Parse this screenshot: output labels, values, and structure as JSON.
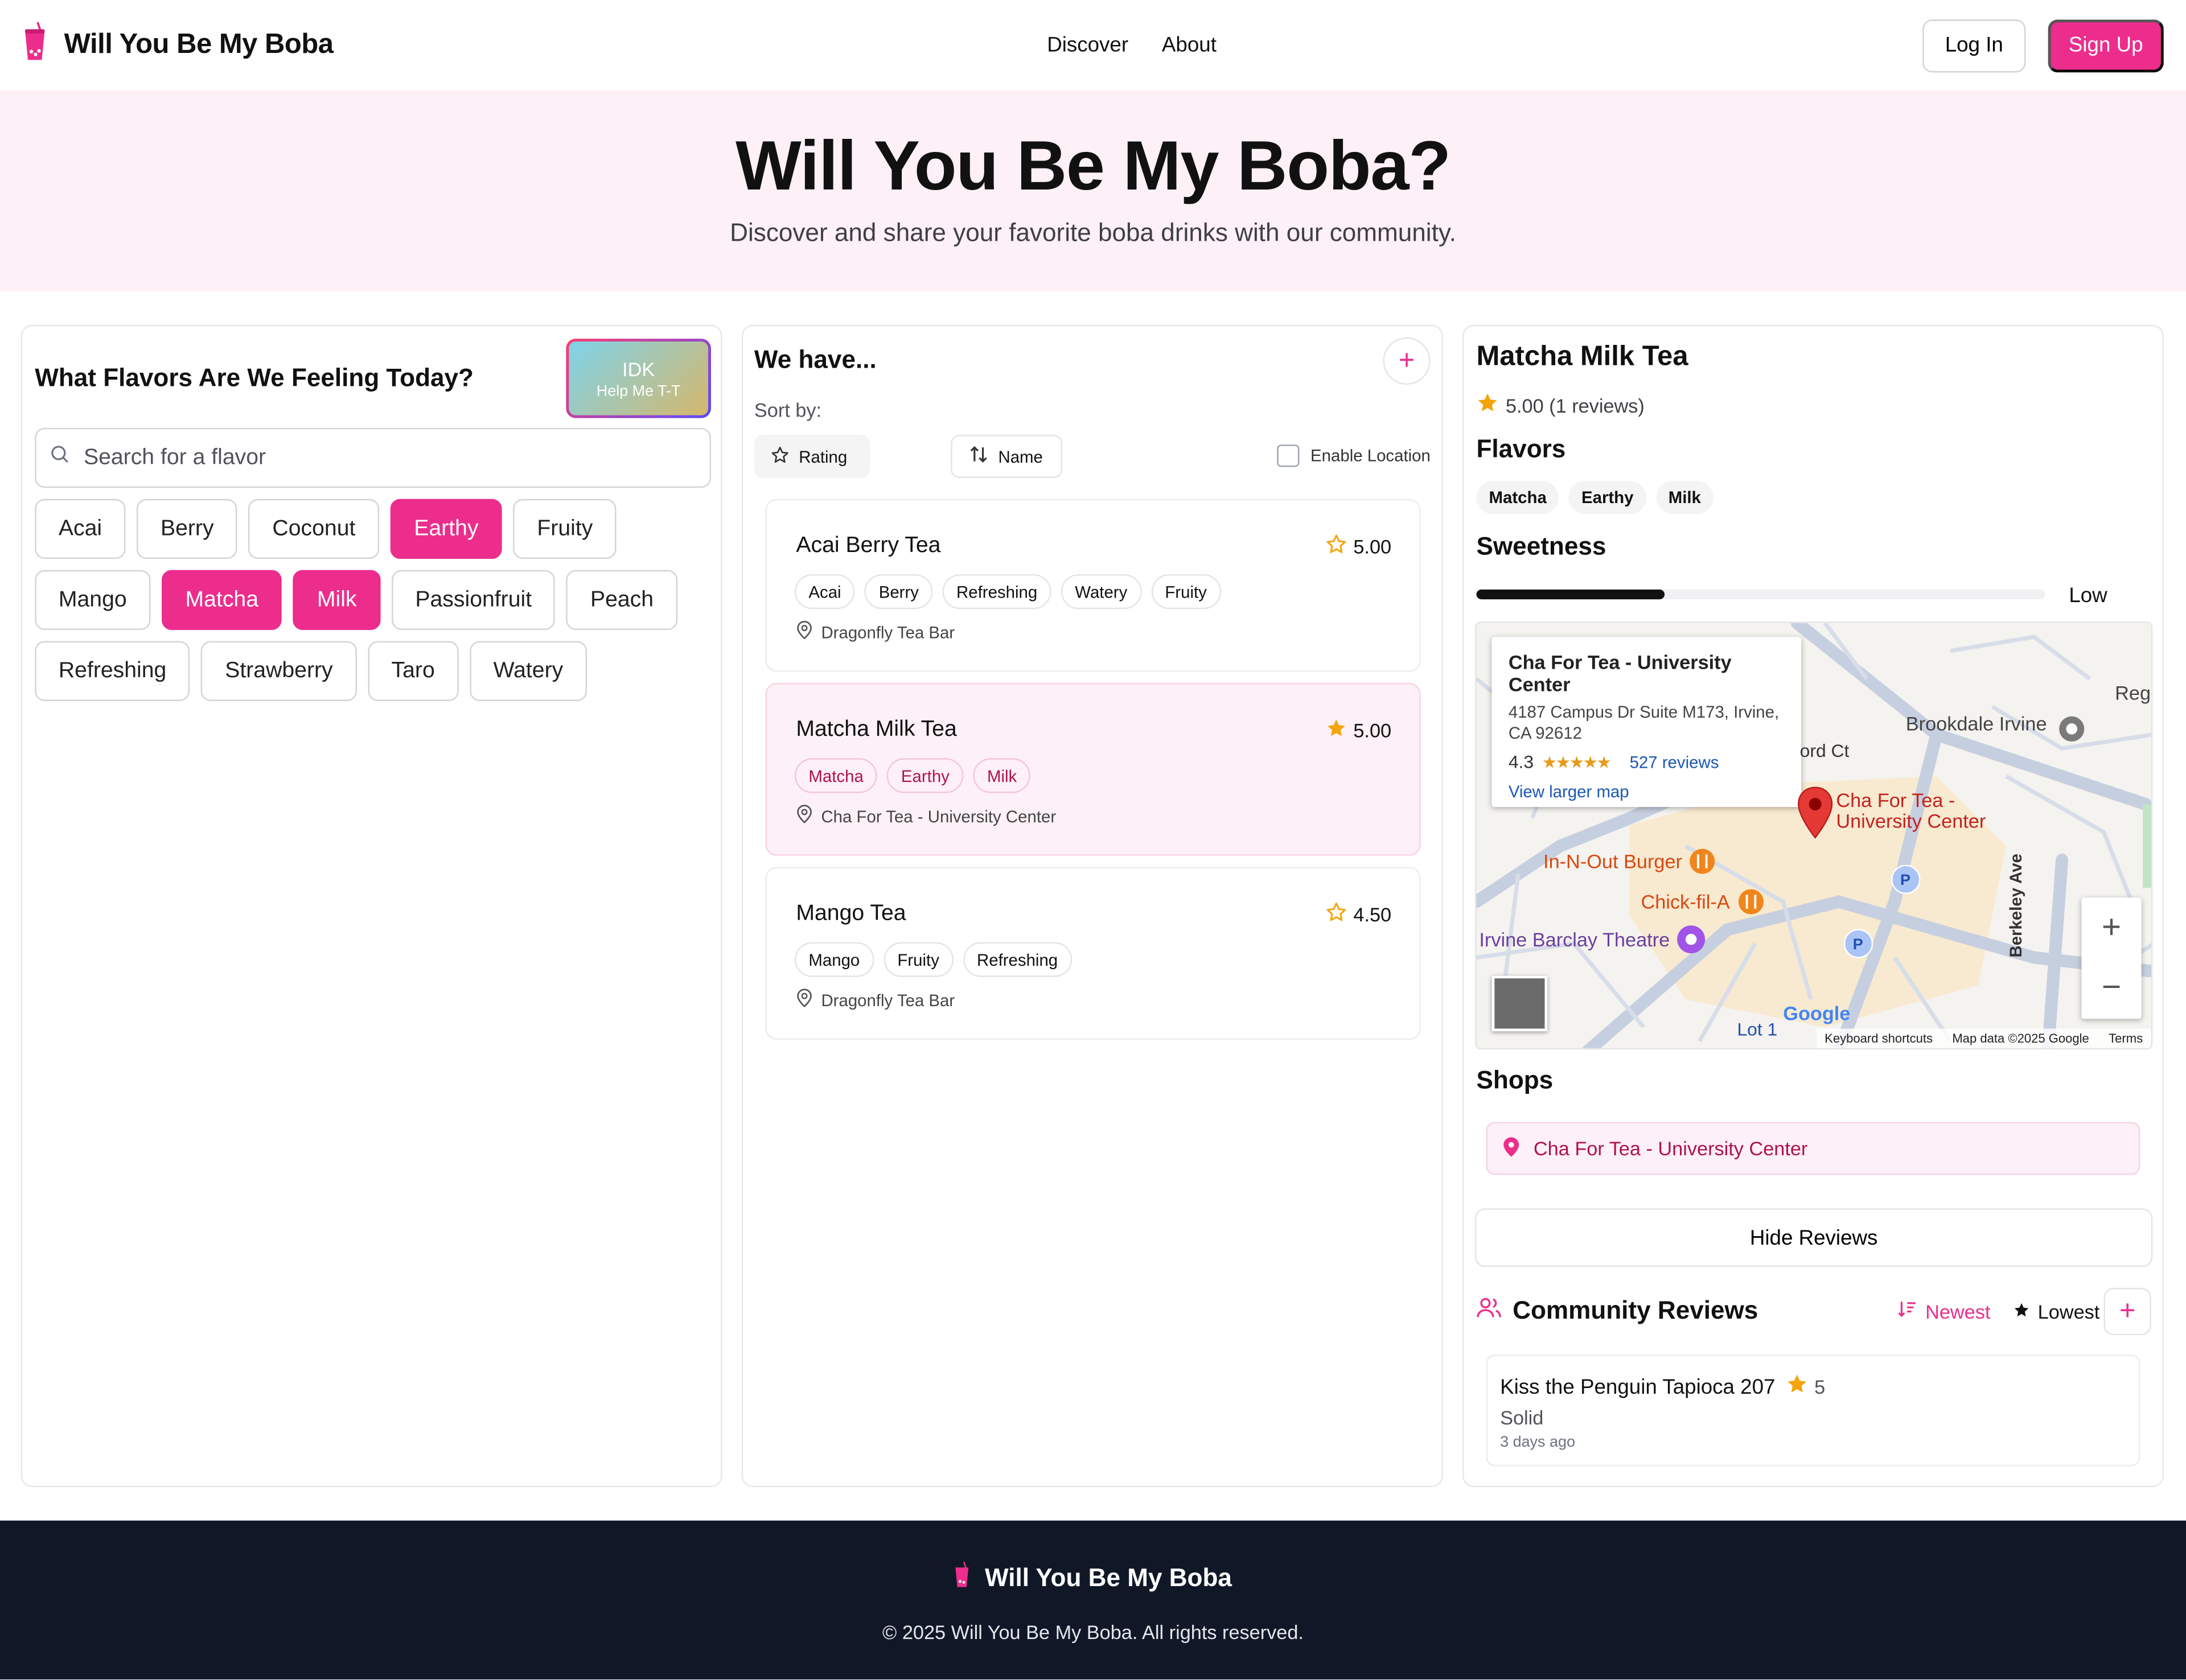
{
  "header": {
    "brand": "Will You Be My Boba",
    "nav": [
      "Discover",
      "About"
    ],
    "login": "Log In",
    "signup": "Sign Up"
  },
  "hero": {
    "title": "Will You Be My Boba?",
    "subtitle": "Discover and share your favorite boba drinks with our community."
  },
  "flavors_panel": {
    "title": "What Flavors Are We Feeling Today?",
    "idk_title": "IDK",
    "idk_sub": "Help Me T-T",
    "search_placeholder": "Search for a flavor",
    "chips": [
      {
        "label": "Acai",
        "selected": false
      },
      {
        "label": "Berry",
        "selected": false
      },
      {
        "label": "Coconut",
        "selected": false
      },
      {
        "label": "Earthy",
        "selected": true
      },
      {
        "label": "Fruity",
        "selected": false
      },
      {
        "label": "Mango",
        "selected": false
      },
      {
        "label": "Matcha",
        "selected": true
      },
      {
        "label": "Milk",
        "selected": true
      },
      {
        "label": "Passionfruit",
        "selected": false
      },
      {
        "label": "Peach",
        "selected": false
      },
      {
        "label": "Refreshing",
        "selected": false
      },
      {
        "label": "Strawberry",
        "selected": false
      },
      {
        "label": "Taro",
        "selected": false
      },
      {
        "label": "Watery",
        "selected": false
      }
    ]
  },
  "drinks_panel": {
    "title": "We have...",
    "sort_label": "Sort by:",
    "sort_rating": "Rating",
    "sort_name": "Name",
    "location_label": "Enable Location",
    "drinks": [
      {
        "name": "Acai Berry Tea",
        "rating": "5.00",
        "tags": [
          "Acai",
          "Berry",
          "Refreshing",
          "Watery",
          "Fruity"
        ],
        "shop": "Dragonfly Tea Bar",
        "selected": false
      },
      {
        "name": "Matcha Milk Tea",
        "rating": "5.00",
        "tags": [
          "Matcha",
          "Earthy",
          "Milk"
        ],
        "shop": "Cha For Tea - University Center",
        "selected": true
      },
      {
        "name": "Mango Tea",
        "rating": "4.50",
        "tags": [
          "Mango",
          "Fruity",
          "Refreshing"
        ],
        "shop": "Dragonfly Tea Bar",
        "selected": false
      }
    ]
  },
  "detail": {
    "title": "Matcha Milk Tea",
    "rating": "5.00 (1 reviews)",
    "flavors_heading": "Flavors",
    "flavors": [
      "Matcha",
      "Earthy",
      "Milk"
    ],
    "sweetness_heading": "Sweetness",
    "sweetness_label": "Low",
    "sweetness_level": 0.33,
    "map": {
      "info_title": "Cha For Tea - University Center",
      "info_address": "4187 Campus Dr Suite M173, Irvine, CA 92612",
      "info_rating": "4.3",
      "info_reviews": "527 reviews",
      "info_link": "View larger map",
      "pin_label": "Cha For Tea - University Center",
      "labels": {
        "brookdale": "Brookdale Irvine",
        "innout": "In-N-Out Burger",
        "chickfila": "Chick-fil-A",
        "barclay": "Irvine Barclay Theatre",
        "berkeley": "Berkeley Ave",
        "ordct": "ord Ct",
        "lot1": "Lot 1",
        "google": "Google",
        "rege": "Rege"
      },
      "footer": [
        "Keyboard shortcuts",
        "Map data ©2025 Google",
        "Terms"
      ]
    },
    "shops_heading": "Shops",
    "shop": "Cha For Tea - University Center",
    "hide_reviews": "Hide Reviews",
    "reviews_heading": "Community Reviews",
    "sort_newest": "Newest",
    "sort_lowest": "Lowest",
    "reviews": [
      {
        "shop": "Kiss the Penguin Tapioca 207",
        "score": "5",
        "text": "Solid",
        "when": "3 days ago"
      }
    ]
  },
  "footer": {
    "brand": "Will You Be My Boba",
    "copyright": "© 2025 Will You Be My Boba. All rights reserved."
  },
  "colors": {
    "accent": "#ec2d8c",
    "footer_bg": "#101828",
    "hero_bg": "#fdf0f6"
  }
}
